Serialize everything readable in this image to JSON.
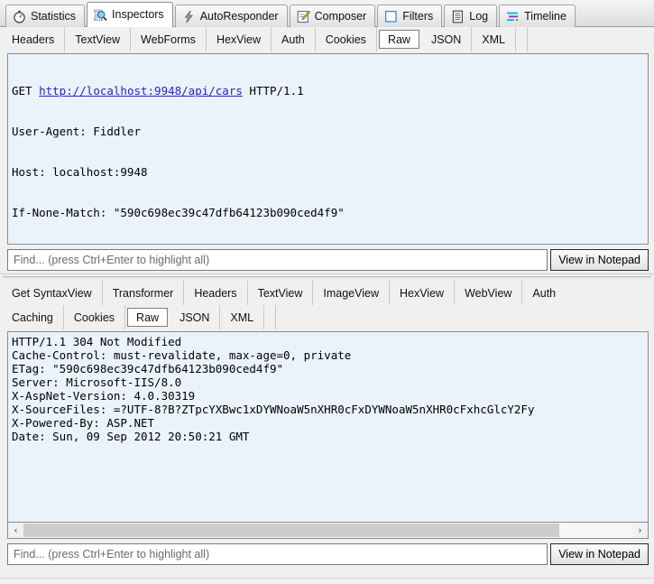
{
  "main_tabs": [
    {
      "label": "Statistics",
      "icon": "stopwatch-icon",
      "active": false
    },
    {
      "label": "Inspectors",
      "icon": "inspectors-icon",
      "active": true
    },
    {
      "label": "AutoResponder",
      "icon": "lightning-bolt-icon",
      "active": false
    },
    {
      "label": "Composer",
      "icon": "compose-pencil-icon",
      "active": false
    },
    {
      "label": "Filters",
      "icon": "filters-square-icon",
      "active": false
    },
    {
      "label": "Log",
      "icon": "log-document-icon",
      "active": false
    },
    {
      "label": "Timeline",
      "icon": "timeline-bars-icon",
      "active": false
    }
  ],
  "request": {
    "tabs": [
      {
        "label": "Headers",
        "selected": false
      },
      {
        "label": "TextView",
        "selected": false
      },
      {
        "label": "WebForms",
        "selected": false
      },
      {
        "label": "HexView",
        "selected": false
      },
      {
        "label": "Auth",
        "selected": false
      },
      {
        "label": "Cookies",
        "selected": false
      },
      {
        "label": "Raw",
        "selected": true
      },
      {
        "label": "JSON",
        "selected": false
      },
      {
        "label": "XML",
        "selected": false
      }
    ],
    "raw_lines": [
      {
        "prefix": "GET ",
        "link": "http://localhost:9948/api/cars",
        "suffix": " HTTP/1.1"
      },
      {
        "text": "User-Agent: Fiddler"
      },
      {
        "text": "Host: localhost:9948"
      },
      {
        "text": "If-None-Match: \"590c698ec39c47dfb64123b090ced4f9\""
      }
    ],
    "find_placeholder": "Find... (press Ctrl+Enter to highlight all)",
    "find_value": "",
    "notepad_button": "View in Notepad"
  },
  "response": {
    "tabs_row1": [
      {
        "label": "Get SyntaxView",
        "selected": false
      },
      {
        "label": "Transformer",
        "selected": false
      },
      {
        "label": "Headers",
        "selected": false
      },
      {
        "label": "TextView",
        "selected": false
      },
      {
        "label": "ImageView",
        "selected": false
      },
      {
        "label": "HexView",
        "selected": false
      },
      {
        "label": "WebView",
        "selected": false
      },
      {
        "label": "Auth",
        "selected": false
      }
    ],
    "tabs_row2": [
      {
        "label": "Caching",
        "selected": false
      },
      {
        "label": "Cookies",
        "selected": false
      },
      {
        "label": "Raw",
        "selected": true
      },
      {
        "label": "JSON",
        "selected": false
      },
      {
        "label": "XML",
        "selected": false
      }
    ],
    "raw_text": "HTTP/1.1 304 Not Modified\nCache-Control: must-revalidate, max-age=0, private\nETag: \"590c698ec39c47dfb64123b090ced4f9\"\nServer: Microsoft-IIS/8.0\nX-AspNet-Version: 4.0.30319\nX-SourceFiles: =?UTF-8?B?ZTpcYXBwc1xDYWNoaW5nXHR0cFxDYWNoaW5nXHR0cFxhcGlcY2Fy\nX-Powered-By: ASP.NET\nDate: Sun, 09 Sep 2012 20:50:21 GMT",
    "find_placeholder": "Find... (press Ctrl+Enter to highlight all)",
    "find_value": "",
    "notepad_button": "View in Notepad",
    "scroll_left_arrow": "‹",
    "scroll_right_arrow": "›"
  },
  "colors": {
    "panel_background": "#f0f0f0",
    "text_panel_background": "#eaf3fb",
    "link": "#2222cc",
    "border": "#8a8a8a",
    "active_tab": "#ffffff"
  }
}
